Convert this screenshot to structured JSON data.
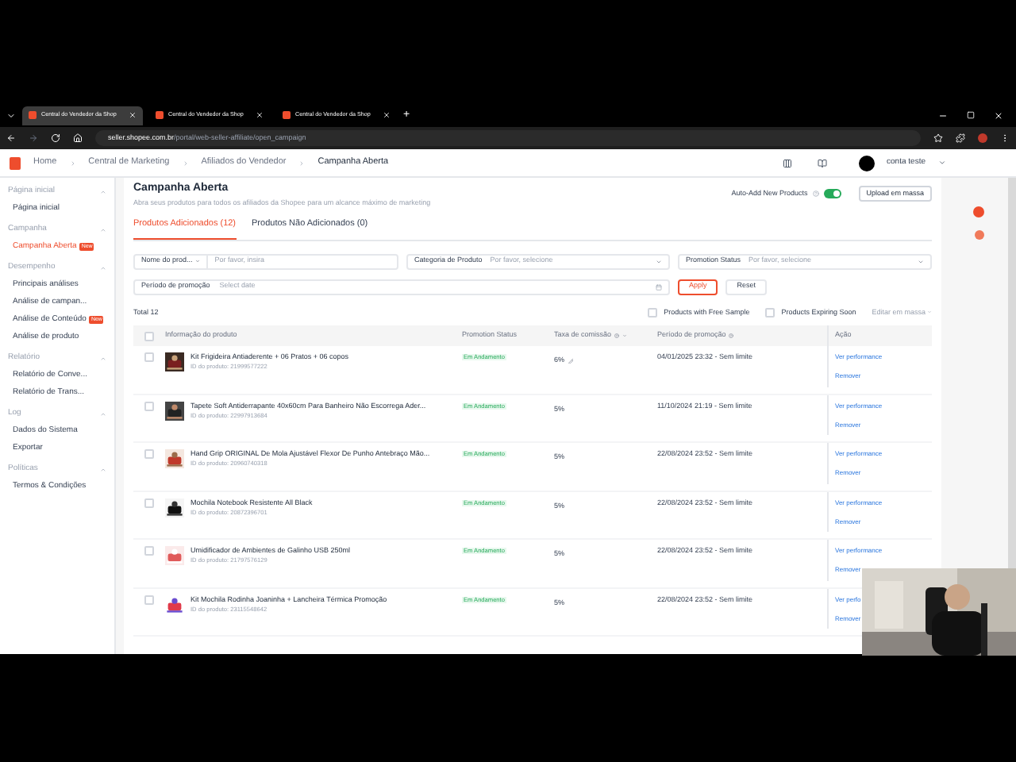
{
  "browser": {
    "tabs": [
      {
        "title": "Central do Vendedor da Shop",
        "selected": true
      },
      {
        "title": "Central do Vendedor da Shop",
        "selected": false
      },
      {
        "title": "Central do Vendedor da Shop",
        "selected": false
      }
    ],
    "new_tab": "+",
    "url_host": "seller.shopee.com.br",
    "url_path": "/portal/web-seller-affiliate/open_campaign"
  },
  "breadcrumb": [
    "Home",
    "Central de Marketing",
    "Afiliados do Vendedor",
    "Campanha Aberta"
  ],
  "user": {
    "name": "conta teste"
  },
  "sidebar": [
    {
      "title": "Página inicial",
      "items": [
        {
          "label": "Página inicial",
          "selected": false
        }
      ]
    },
    {
      "title": "Campanha",
      "items": [
        {
          "label": "Campanha Aberta",
          "selected": true,
          "badge": "New"
        }
      ]
    },
    {
      "title": "Desempenho",
      "items": [
        {
          "label": "Principais análises",
          "selected": false
        },
        {
          "label": "Análise de campan...",
          "selected": false
        },
        {
          "label": "Análise de Conteúdo",
          "selected": false,
          "badge": "New"
        },
        {
          "label": "Análise de produto",
          "selected": false
        }
      ]
    },
    {
      "title": "Relatório",
      "items": [
        {
          "label": "Relatório de Conve...",
          "selected": false
        },
        {
          "label": "Relatório de Trans...",
          "selected": false
        }
      ]
    },
    {
      "title": "Log",
      "items": [
        {
          "label": "Dados do Sistema",
          "selected": false
        },
        {
          "label": "Exportar",
          "selected": false
        }
      ]
    },
    {
      "title": "Políticas",
      "items": [
        {
          "label": "Termos & Condições",
          "selected": false
        }
      ]
    }
  ],
  "page": {
    "title": "Campanha Aberta",
    "subtitle": "Abra seus produtos para todos os afiliados da Shopee para um alcance máximo de marketing",
    "auto_add_label": "Auto-Add New Products",
    "auto_add_on": true,
    "upload_button": "Upload em massa"
  },
  "tabs": [
    {
      "label": "Produtos Adicionados (12)",
      "selected": true
    },
    {
      "label": "Produtos Não Adicionados (0)",
      "selected": false
    }
  ],
  "filters": {
    "name_select": "Nome do prod...",
    "name_placeholder": "Por favor, insira",
    "category_label": "Categoria de Produto",
    "category_placeholder": "Por favor, selecione",
    "status_label": "Promotion Status",
    "status_placeholder": "Por favor, selecione",
    "period_label": "Período de promoção",
    "period_placeholder": "Select date",
    "apply": "Apply",
    "reset": "Reset"
  },
  "total": "Total 12",
  "free_sample": {
    "label": "Products with Free Sample",
    "checked": false
  },
  "expiring": {
    "label": "Products Expiring Soon",
    "checked": false
  },
  "bulk_edit": "Editar em massa",
  "table": {
    "all_checked": false,
    "columns": [
      "Informação do produto",
      "Promotion Status",
      "Taxa de comissão",
      "Período de promoção",
      "Ação"
    ],
    "rows": [
      {
        "checked": false,
        "name": "Kit Frigideira Antiaderente + 06 Pratos + 06 copos",
        "id": "ID do produto: 21999577222",
        "status": "Em Andamento",
        "rate": "6%",
        "editable": true,
        "period": "04/01/2025 23:32 - Sem limite",
        "performance": "Ver performance",
        "remove": "Remover"
      },
      {
        "checked": false,
        "name": "Tapete Soft Antiderrapante 40x60cm Para Banheiro Não Escorrega Ader...",
        "id": "ID do produto: 22997913684",
        "status": "Em Andamento",
        "rate": "5%",
        "editable": false,
        "period": "11/10/2024 21:19 - Sem limite",
        "performance": "Ver performance",
        "remove": "Remover"
      },
      {
        "checked": false,
        "name": "Hand Grip ORIGINAL De Mola Ajustável Flexor De Punho Antebraço Mão...",
        "id": "ID do produto: 20960740318",
        "status": "Em Andamento",
        "rate": "5%",
        "editable": false,
        "period": "22/08/2024 23:52 - Sem limite",
        "performance": "Ver performance",
        "remove": "Remover"
      },
      {
        "checked": false,
        "name": "Mochila Notebook Resistente All Black",
        "id": "ID do produto: 20872396701",
        "status": "Em Andamento",
        "rate": "5%",
        "editable": false,
        "period": "22/08/2024 23:52 - Sem limite",
        "performance": "Ver performance",
        "remove": "Remover"
      },
      {
        "checked": false,
        "name": "Umidificador de Ambientes de Galinho USB 250ml",
        "id": "ID do produto: 21797576129",
        "status": "Em Andamento",
        "rate": "5%",
        "editable": false,
        "period": "22/08/2024 23:52 - Sem limite",
        "performance": "Ver performance",
        "remove": "Remover"
      },
      {
        "checked": false,
        "name": "Kit Mochila Rodinha Joaninha + Lancheira Térmica Promoção",
        "id": "ID do produto: 23115548642",
        "status": "Em Andamento",
        "rate": "5%",
        "editable": false,
        "period": "22/08/2024 23:52 - Sem limite",
        "performance": "Ver perfo",
        "remove": "Remover"
      }
    ]
  }
}
